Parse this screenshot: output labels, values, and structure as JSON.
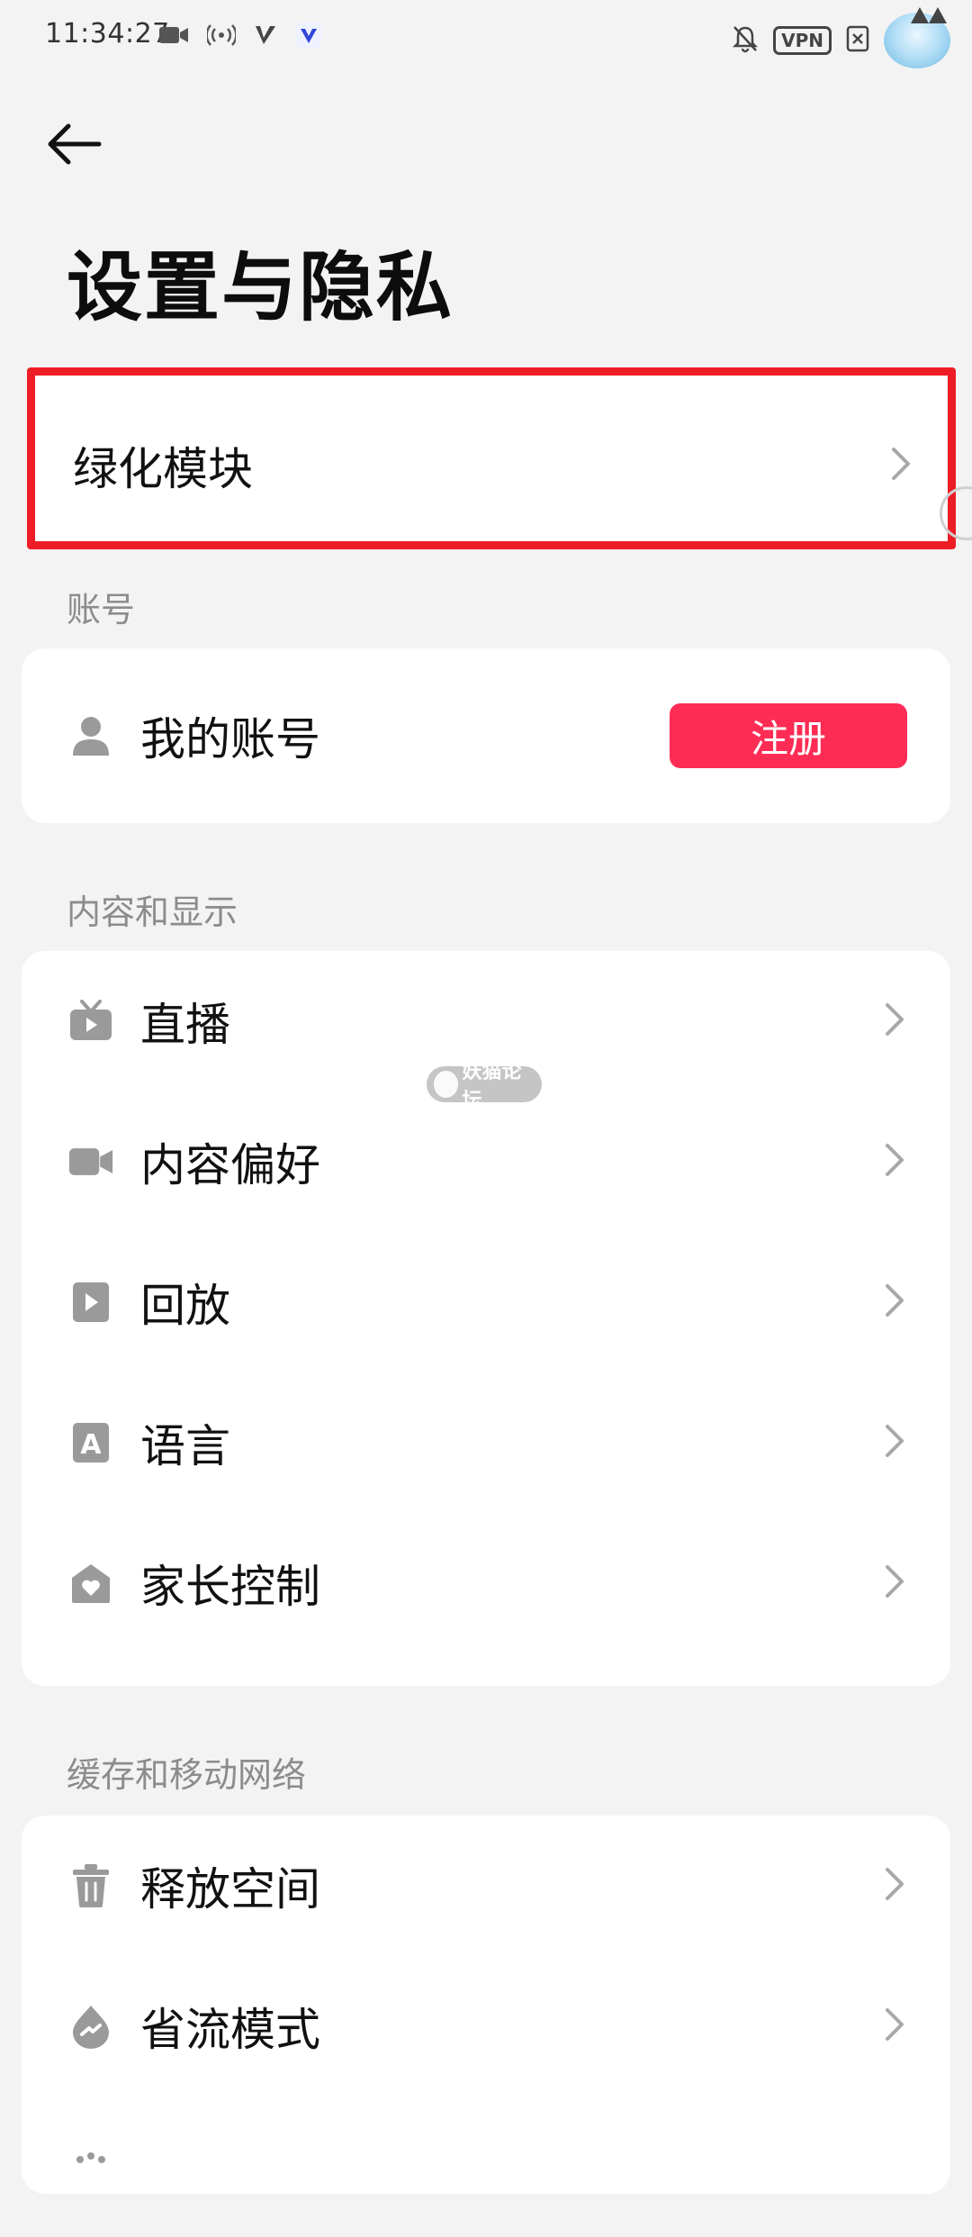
{
  "status_bar": {
    "time": "11:34:27",
    "left_icons": [
      "video-camera-icon",
      "hotspot-icon",
      "v-logo-icon",
      "blue-v-app-icon"
    ],
    "right_icons": [
      "muted-bell-icon",
      "vpn-icon",
      "x-notification-icon",
      "anime-avatar"
    ],
    "vpn_label": "VPN"
  },
  "header": {
    "back_icon": "arrow-left-icon",
    "title": "设置与隐私"
  },
  "highlighted_item": {
    "label": "绿化模块",
    "icon": "chevron-right-icon",
    "outline_color": "#ee1d25"
  },
  "sections": {
    "account": {
      "label": "账号",
      "items": [
        {
          "label": "我的账号",
          "icon": "user-icon",
          "action_label": "注册"
        }
      ]
    },
    "content_display": {
      "label": "内容和显示",
      "items": [
        {
          "label": "直播",
          "icon": "tv-icon"
        },
        {
          "label": "内容偏好",
          "icon": "video-camera-icon"
        },
        {
          "label": "回放",
          "icon": "play-icon"
        },
        {
          "label": "语言",
          "icon": "language-icon",
          "icon_glyph": "A"
        },
        {
          "label": "家长控制",
          "icon": "house-heart-icon"
        }
      ]
    },
    "cache_network": {
      "label": "缓存和移动网络",
      "items": [
        {
          "label": "释放空间",
          "icon": "trash-icon"
        },
        {
          "label": "省流模式",
          "icon": "data-saver-icon"
        }
      ]
    }
  },
  "watermark": {
    "text": "妖猫论坛"
  },
  "colors": {
    "background": "#f3f3f3",
    "card": "#ffffff",
    "accent_pink": "#fe2c55",
    "icon_gray": "#9a9a9a",
    "chevron_gray": "#a8a8a8",
    "section_label_gray": "#8c8c8c"
  }
}
